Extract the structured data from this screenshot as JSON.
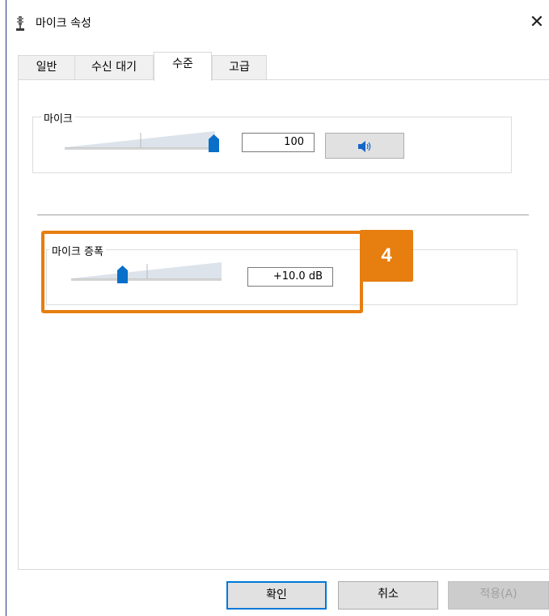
{
  "window": {
    "title": "마이크 속성",
    "close_label": "✕"
  },
  "tabs": [
    {
      "label": "일반"
    },
    {
      "label": "수신 대기"
    },
    {
      "label": "수준",
      "active": true
    },
    {
      "label": "고급"
    }
  ],
  "microphone": {
    "label": "마이크",
    "level": 100,
    "level_text": "100",
    "mute_icon": "speaker-icon"
  },
  "boost": {
    "label": "마이크 증폭",
    "level_fraction": 0.33,
    "value_text": "+10.0 dB"
  },
  "callout": {
    "number": "4",
    "color": "#e67e10"
  },
  "buttons": {
    "ok": "확인",
    "cancel": "취소",
    "apply": "적용(A)"
  },
  "colors": {
    "accent": "#0078d7",
    "thumb": "#0a6fc9"
  }
}
